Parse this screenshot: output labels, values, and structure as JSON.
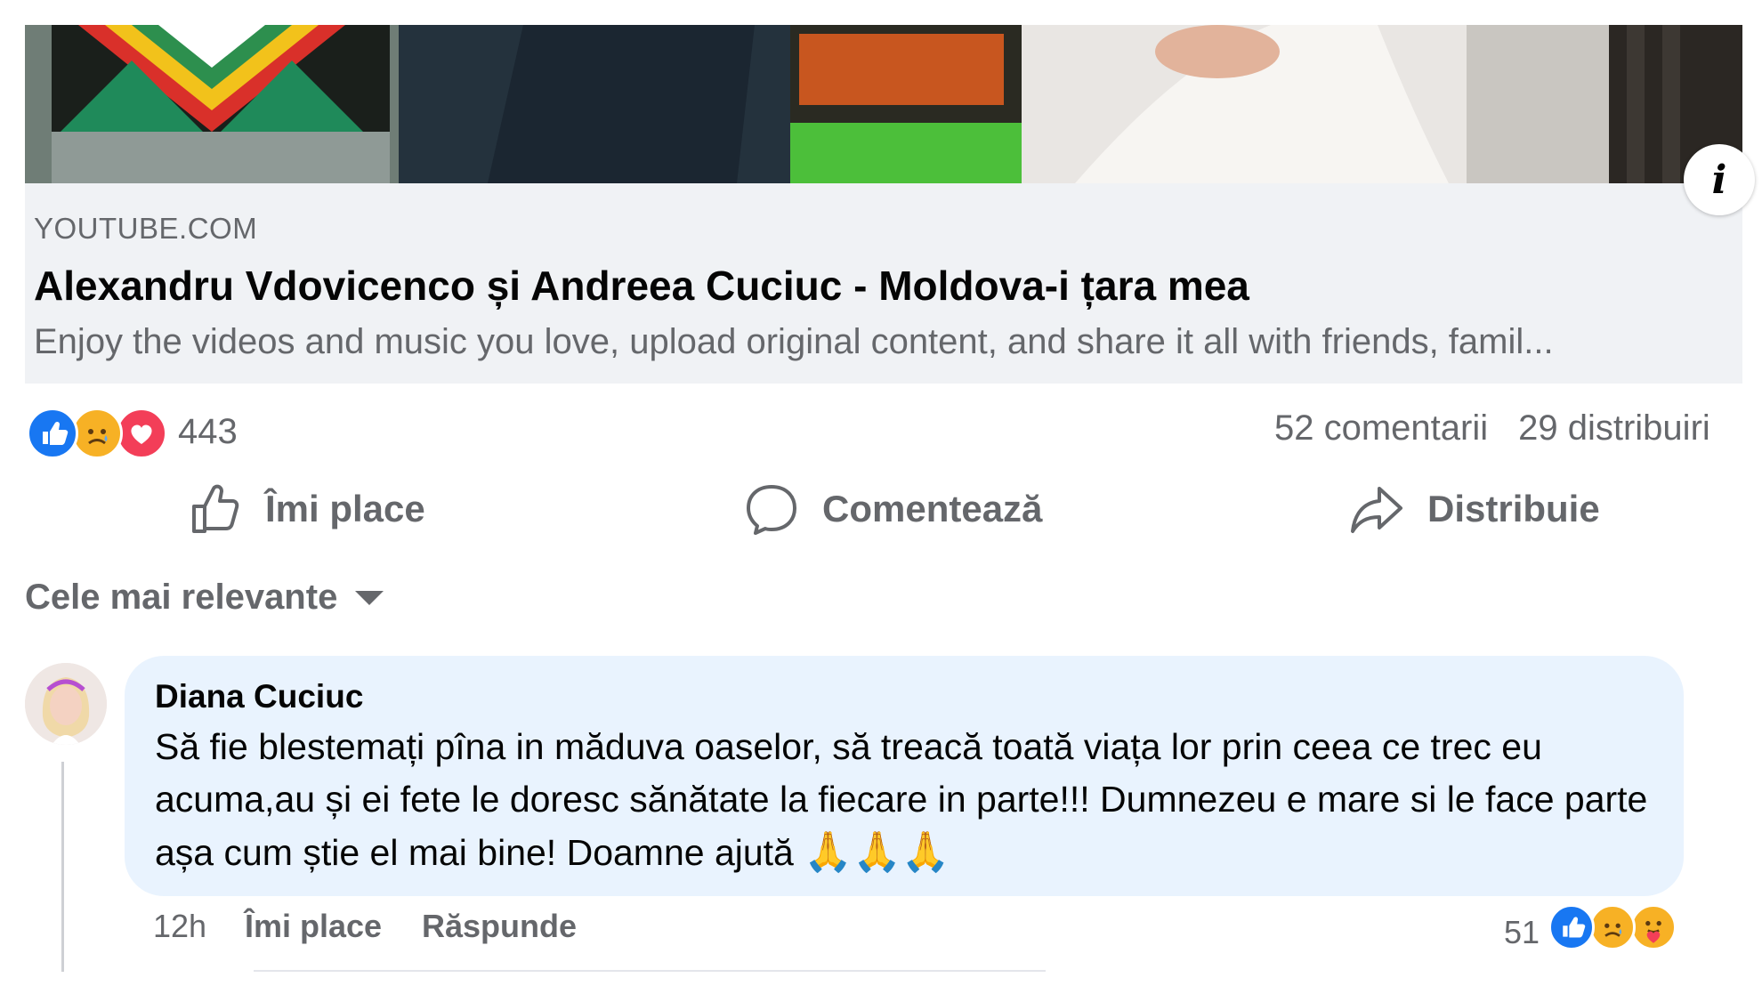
{
  "preview": {
    "domain": "YOUTUBE.COM",
    "title": "Alexandru Vdovicenco și Andreea Cuciuc - Moldova-i țara mea",
    "description": "Enjoy the videos and music you love, upload original content, and share it all with friends, famil...",
    "info_glyph": "i"
  },
  "reactions": {
    "icons": [
      "like-icon",
      "sad-icon",
      "love-icon"
    ],
    "count": "443",
    "comments": "52 comentarii",
    "shares": "29 distribuiri"
  },
  "actions": {
    "like": "Îmi place",
    "comment": "Comentează",
    "share": "Distribuie"
  },
  "sort": {
    "label": "Cele mai relevante"
  },
  "comment": {
    "author": "Diana Cuciuc",
    "text": "Să fie blestemați pîna in măduva oaselor, să treacă toată viața lor prin ceea ce trec eu acuma,au și ei fete le doresc sănătate la fiecare in parte!!! Dumnezeu e mare si le face parte așa cum știe el mai bine! Doamne ajută",
    "emojis": "🙏🙏🙏",
    "time": "12h",
    "like_label": "Îmi place",
    "reply_label": "Răspunde",
    "reaction_count": "51",
    "reaction_icons": [
      "like-icon",
      "sad-icon",
      "care-icon"
    ]
  },
  "colors": {
    "brand_blue": "#1877f2",
    "secondary_text": "#65676b",
    "bubble_bg": "#e9f3fe",
    "preview_bg": "#f0f2f5"
  }
}
